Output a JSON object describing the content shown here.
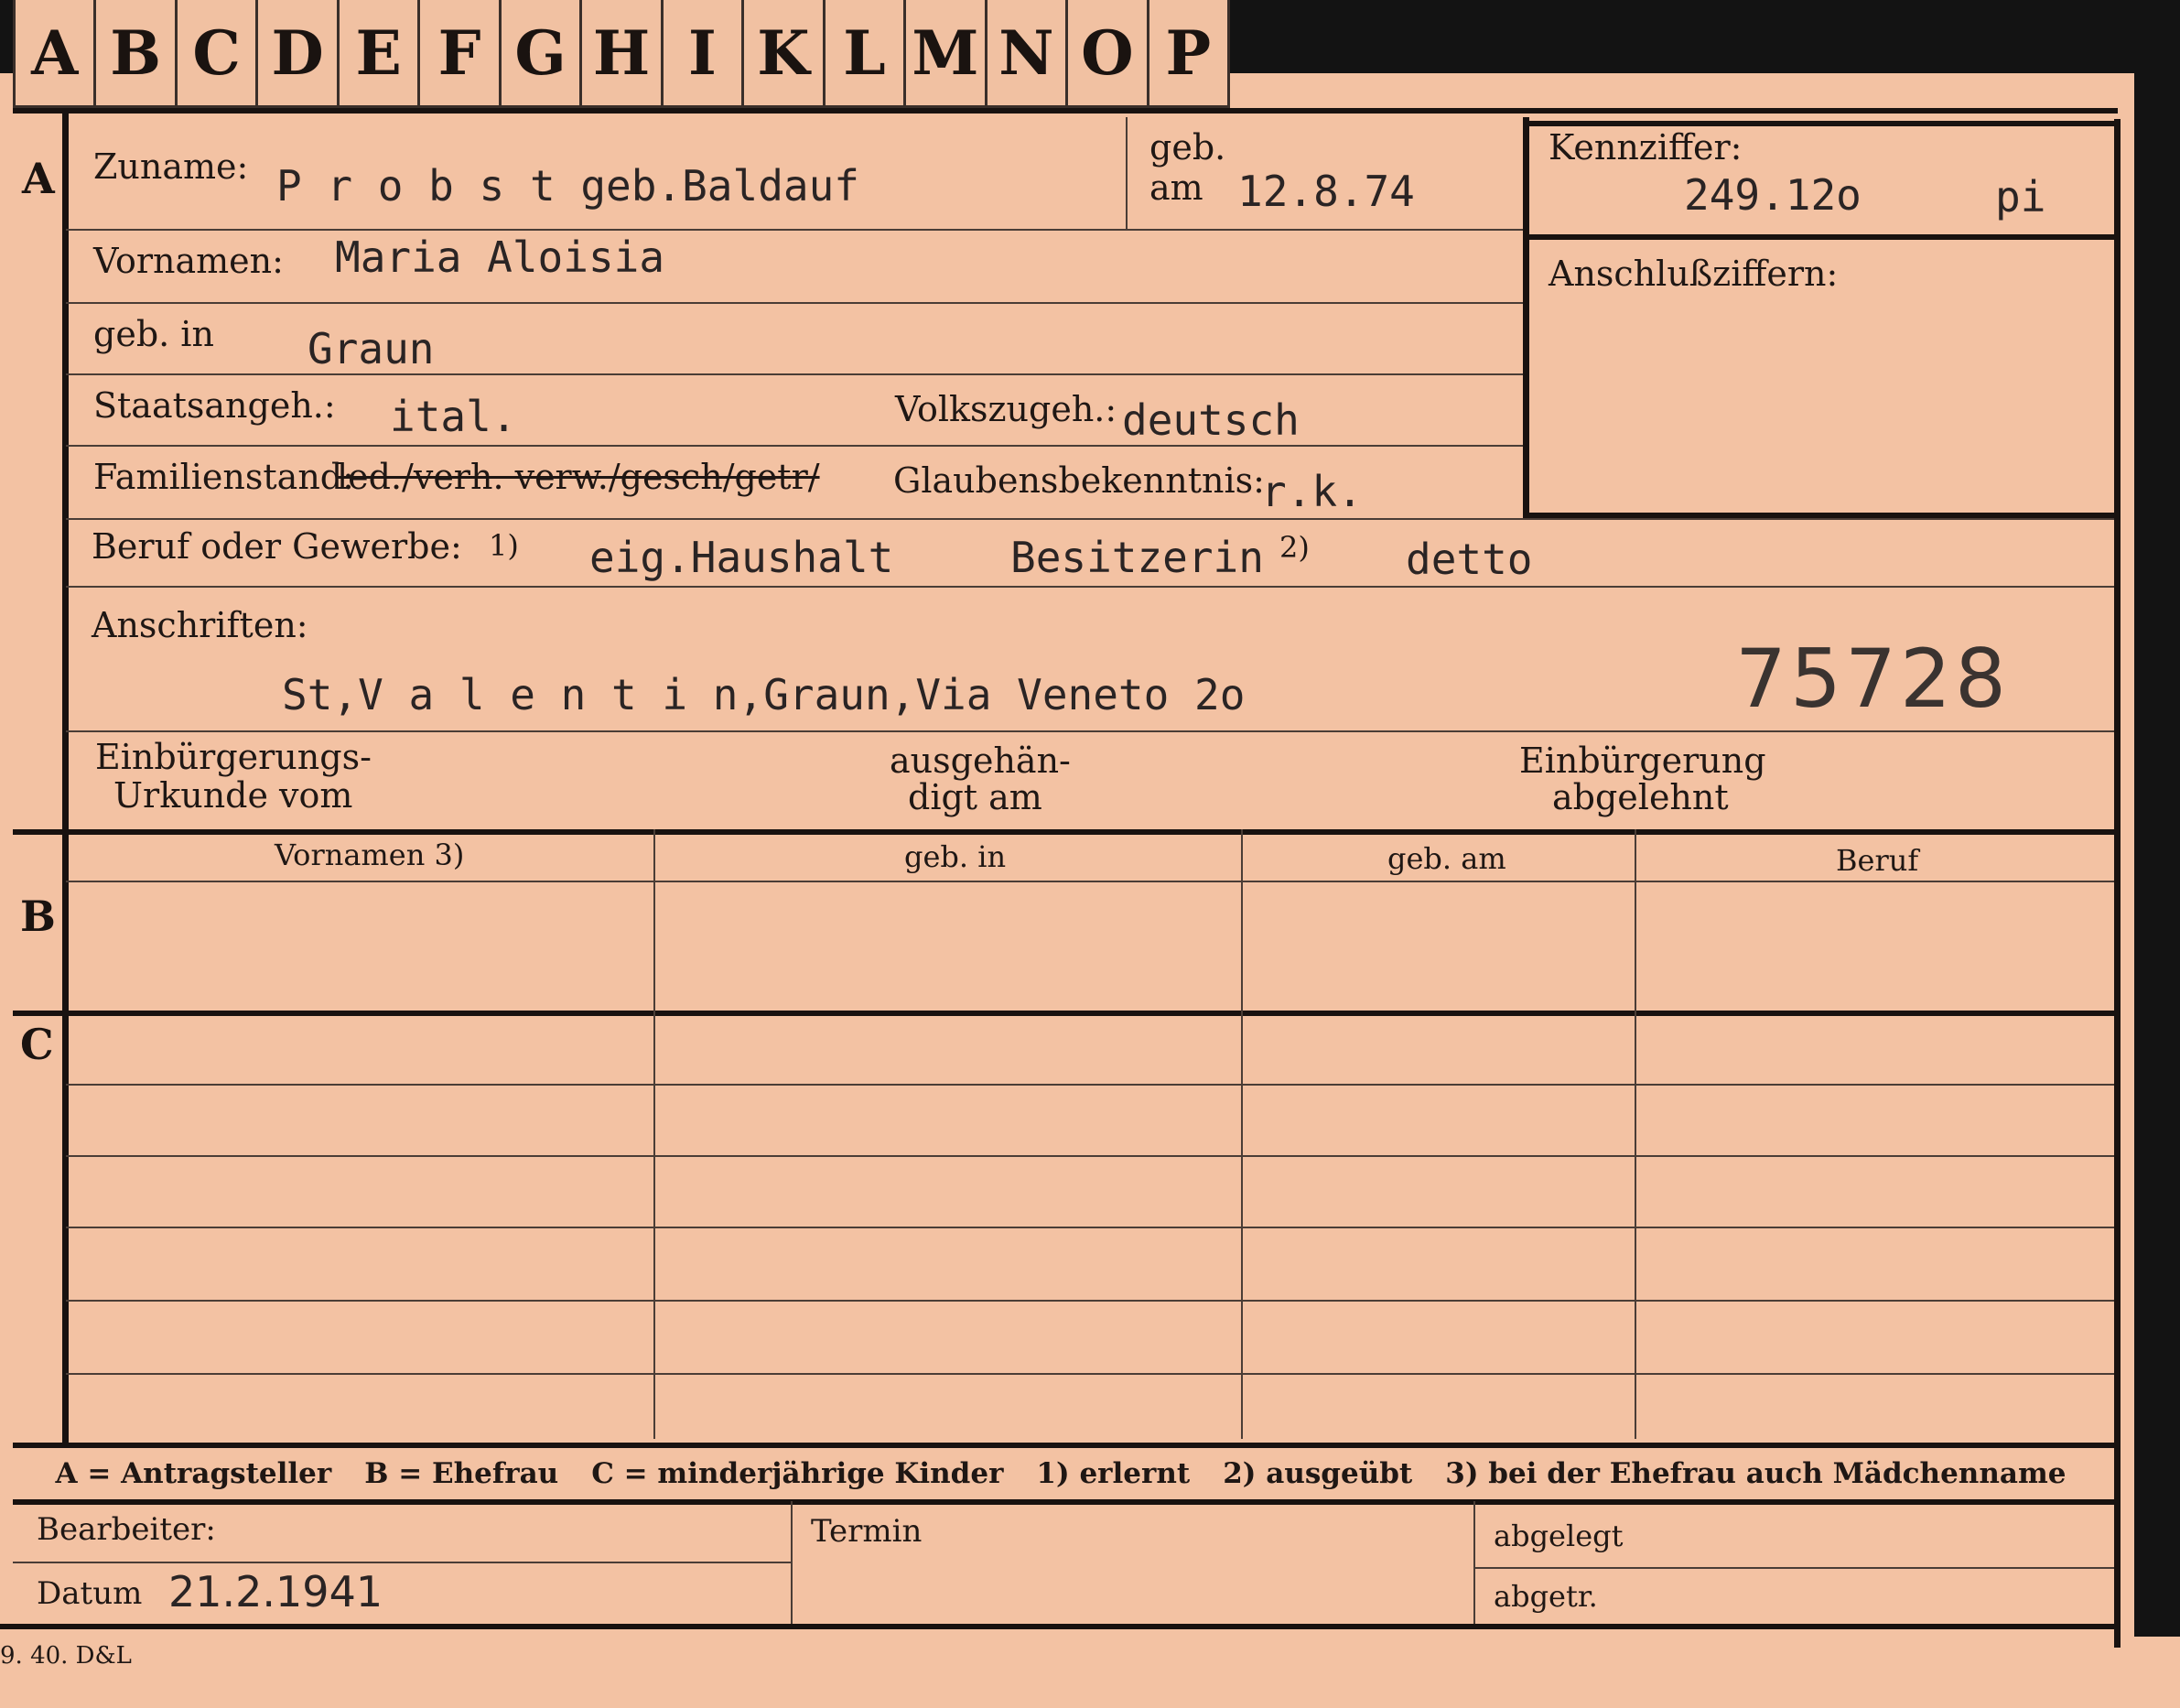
{
  "tabs": [
    "A",
    "B",
    "C",
    "D",
    "E",
    "F",
    "G",
    "H",
    "I",
    "K",
    "L",
    "M",
    "N",
    "O",
    "P"
  ],
  "section_a": {
    "letter": "A",
    "surname_label": "Zuname:",
    "surname": "P r o b s t  geb.Baldauf",
    "born_label_1": "geb.",
    "born_label_2": "am",
    "born_date": "12.8.74",
    "firstnames_label": "Vornamen:",
    "firstnames": "Maria Aloisia",
    "birthplace_label": "geb. in",
    "birthplace": "Graun",
    "citizenship_label": "Staatsangeh.:",
    "citizenship": "ital.",
    "ethnicity_label": "Volkszugeh.:",
    "ethnicity": "deutsch",
    "marital_label": "Familienstand:",
    "marital_options": "led./verh. verw./gesch/getr/",
    "religion_label": "Glaubensbekenntnis:",
    "religion": "r.k.",
    "occupation_label": "Beruf oder Gewerbe:",
    "footnote_1": "1)",
    "occupation_learned": "eig.Haushalt",
    "occupation_practiced": "Besitzerin",
    "footnote_2": "2)",
    "occupation_practiced_2": "detto",
    "address_label": "Anschriften:",
    "address": "St,V a l e n t i n,Graun,Via Veneto 2o",
    "number": "75728",
    "naturalization_doc_label_1": "Einbürgerungs-",
    "naturalization_doc_label_2": "Urkunde vom",
    "handed_label_1": "ausgehän-",
    "handed_label_2": "digt am",
    "rejected_label_1": "Einbürgerung",
    "rejected_label_2": "abgelehnt"
  },
  "id_box": {
    "label": "Kennziffer:",
    "value": "249.12o",
    "suffix": "pi",
    "linked_label": "Anschlußziffern:"
  },
  "section_b": {
    "letter": "B",
    "columns": [
      "Vornamen 3)",
      "geb. in",
      "geb. am",
      "Beruf"
    ]
  },
  "section_c": {
    "letter": "C"
  },
  "legend": [
    "A = Antragsteller",
    "B = Ehefrau",
    "C = minderjährige Kinder",
    "1) erlernt",
    "2) ausgeübt",
    "3) bei der Ehefrau auch Mädchenname"
  ],
  "footer": {
    "clerk_label": "Bearbeiter:",
    "date_label": "Datum",
    "date": "21.2.1941",
    "deadline_label": "Termin",
    "filed_label": "abgelegt",
    "filed2_label": "abgetr.",
    "print_mark": "9. 40. D&L"
  },
  "colors": {
    "card": "#f3c2a3",
    "ink": "#1f1714",
    "background": "#131313"
  }
}
